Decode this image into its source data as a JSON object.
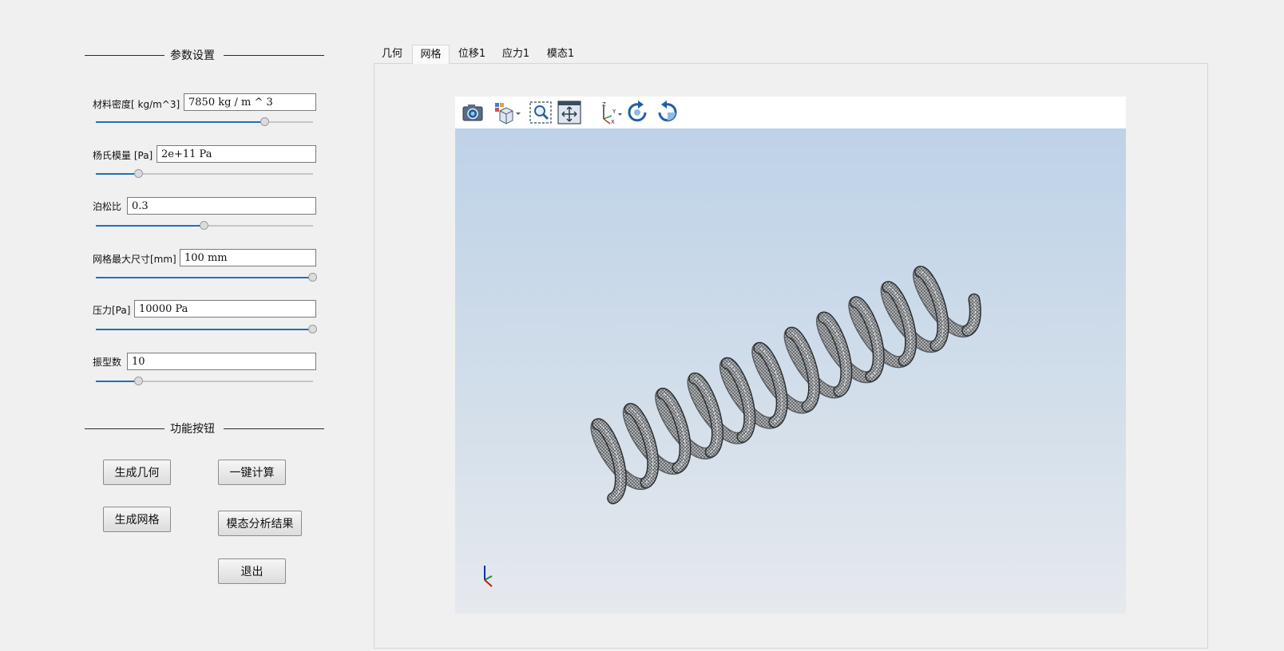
{
  "params_group": {
    "title": "参数设置",
    "rows": [
      {
        "label": "材料密度[ kg/m^3]",
        "value": "7850 kg / m ^ 3",
        "slider": 0.78
      },
      {
        "label": "杨氏模量 [Pa]",
        "value": "2e+11 Pa",
        "slider": 0.2
      },
      {
        "label": "泊松比",
        "value": "0.3",
        "slider": 0.5
      },
      {
        "label": "网格最大尺寸[mm]",
        "value": "100 mm",
        "slider": 1.0
      },
      {
        "label": "压力[Pa]",
        "value": "10000 Pa",
        "slider": 1.0
      },
      {
        "label": "振型数",
        "value": "10",
        "slider": 0.2
      }
    ]
  },
  "functions_group": {
    "title": "功能按钮",
    "buttons": {
      "gen_geometry": "生成几何",
      "compute": "一键计算",
      "gen_mesh": "生成网格",
      "modal_result": "模态分析结果",
      "exit": "退出"
    }
  },
  "tabs": [
    {
      "label": "几何",
      "active": false
    },
    {
      "label": "网格",
      "active": true
    },
    {
      "label": "位移1",
      "active": false
    },
    {
      "label": "应力1",
      "active": false
    },
    {
      "label": "模态1",
      "active": false
    }
  ],
  "viewer": {
    "toolbar_icons": [
      "camera-icon",
      "view-cube-icon",
      "zoom-box-icon",
      "fit-all-icon",
      "axes-icon",
      "rotate-cw-icon",
      "rotate-ccw-icon"
    ],
    "model": "spring-mesh",
    "colors": {
      "accent": "#1f6fc0",
      "bg_top": "#bed2e8",
      "bg_bottom": "#e6e9ee"
    }
  }
}
